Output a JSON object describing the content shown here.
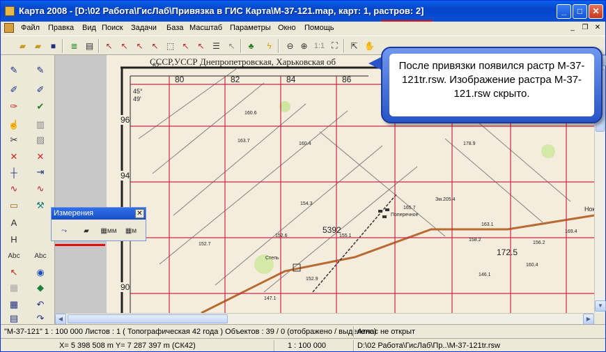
{
  "window": {
    "title": "Карта 2008 - [D:\\02 Работа\\ГисЛаб\\Привязка в ГИС Карта\\М-37-121.map, карт: 1, растров: 2]"
  },
  "menu": [
    "Файл",
    "Правка",
    "Вид",
    "Поиск",
    "Задачи",
    "База",
    "Масштаб",
    "Параметры",
    "Окно",
    "Помощь"
  ],
  "toolbar": {
    "zoom_label": "1:1"
  },
  "callout": {
    "text": "После привязки появился растр M-37-121tr.rsw. Изображение растра M-37-121.rsw скрыто."
  },
  "measure_panel": {
    "title": "Измерения",
    "tool3_label": "мм",
    "tool4_label": "м"
  },
  "map": {
    "header_text": "СССР,УССР Днепропетровская, Харьковская об",
    "grid_x_labels": [
      "80",
      "82",
      "84",
      "86"
    ],
    "grid_y_labels": [
      "96",
      "94",
      "92",
      "90"
    ],
    "corner_labels": [
      "62'",
      "45°",
      "49'"
    ],
    "elevations": [
      "160.6",
      "163.7",
      "160.4",
      "178.9",
      "165.7",
      "154.3",
      "152.6",
      "155.1",
      "152.9",
      "147.1",
      "146.1",
      "163.1",
      "158.2",
      "156.2",
      "169.4",
      "172.5",
      "160.4",
      "152.7"
    ],
    "big_number": "5392",
    "village_label": "Поперечное",
    "place_label": "Степь",
    "cut_label": "Нок",
    "lake_label": "Зм.205.4"
  },
  "status": {
    "map_name": "\"M-37-121\"   1 : 100 000   Листов : 1   ( Топографическая 42 года )  Объектов : 39 / 0 (отображено / выделено)",
    "atlas": "Атлас не открыт",
    "coords": "X=   5 398 508 m     Y=    7 287 397 m  (СК42)",
    "scale": "1 : 100 000",
    "path": "D:\\02 Работа\\ГисЛаб\\Пр..\\M-37-121tr.rsw"
  },
  "colors": {
    "title_bar": "#0a4fd6",
    "grid_red": "#c8284a",
    "callout_blue": "#2854c8",
    "highlight_red": "#e01010"
  }
}
